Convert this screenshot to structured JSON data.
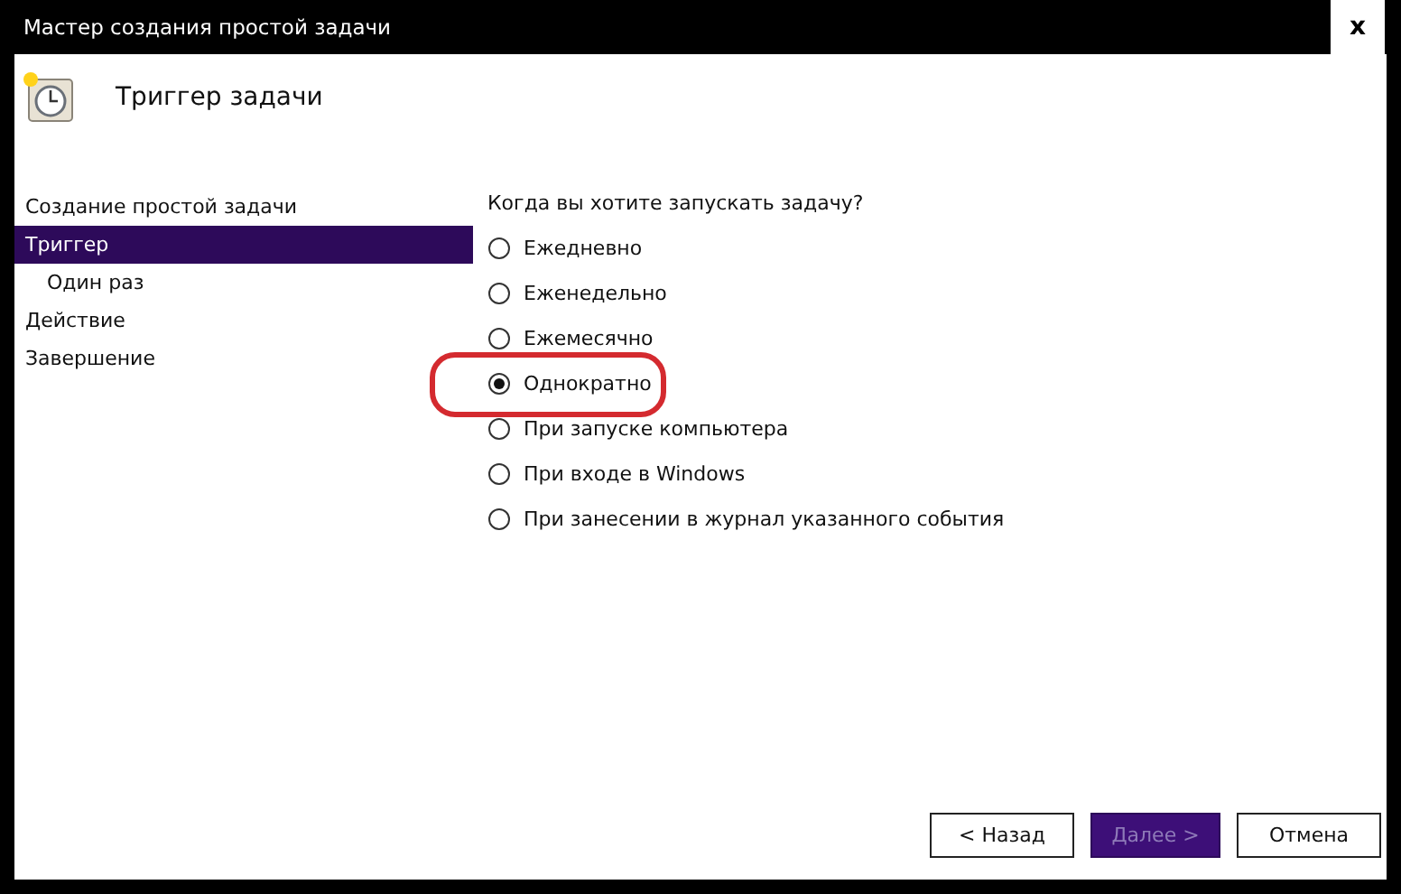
{
  "window": {
    "title": "Мастер создания простой задачи",
    "close": "x"
  },
  "header": {
    "title": "Триггер задачи"
  },
  "sidebar": {
    "items": [
      {
        "label": "Создание простой задачи",
        "selected": false
      },
      {
        "label": "Триггер",
        "selected": true,
        "children": [
          {
            "label": "Один раз",
            "selected": false
          }
        ]
      },
      {
        "label": "Действие",
        "selected": false
      },
      {
        "label": "Завершение",
        "selected": false
      }
    ]
  },
  "question": "Когда вы хотите запускать задачу?",
  "options": [
    {
      "label": "Ежедневно",
      "selected": false,
      "highlighted": false
    },
    {
      "label": "Еженедельно",
      "selected": false,
      "highlighted": false
    },
    {
      "label": "Ежемесячно",
      "selected": false,
      "highlighted": false
    },
    {
      "label": "Однократно",
      "selected": true,
      "highlighted": true
    },
    {
      "label": "При запуске компьютера",
      "selected": false,
      "highlighted": false
    },
    {
      "label": "При входе в Windows",
      "selected": false,
      "highlighted": false
    },
    {
      "label": "При занесении в журнал указанного события",
      "selected": false,
      "highlighted": false
    }
  ],
  "buttons": [
    {
      "label": "< Назад",
      "kind": "normal"
    },
    {
      "label": "Далее >",
      "kind": "primary"
    },
    {
      "label": "Отмена",
      "kind": "normal"
    }
  ]
}
